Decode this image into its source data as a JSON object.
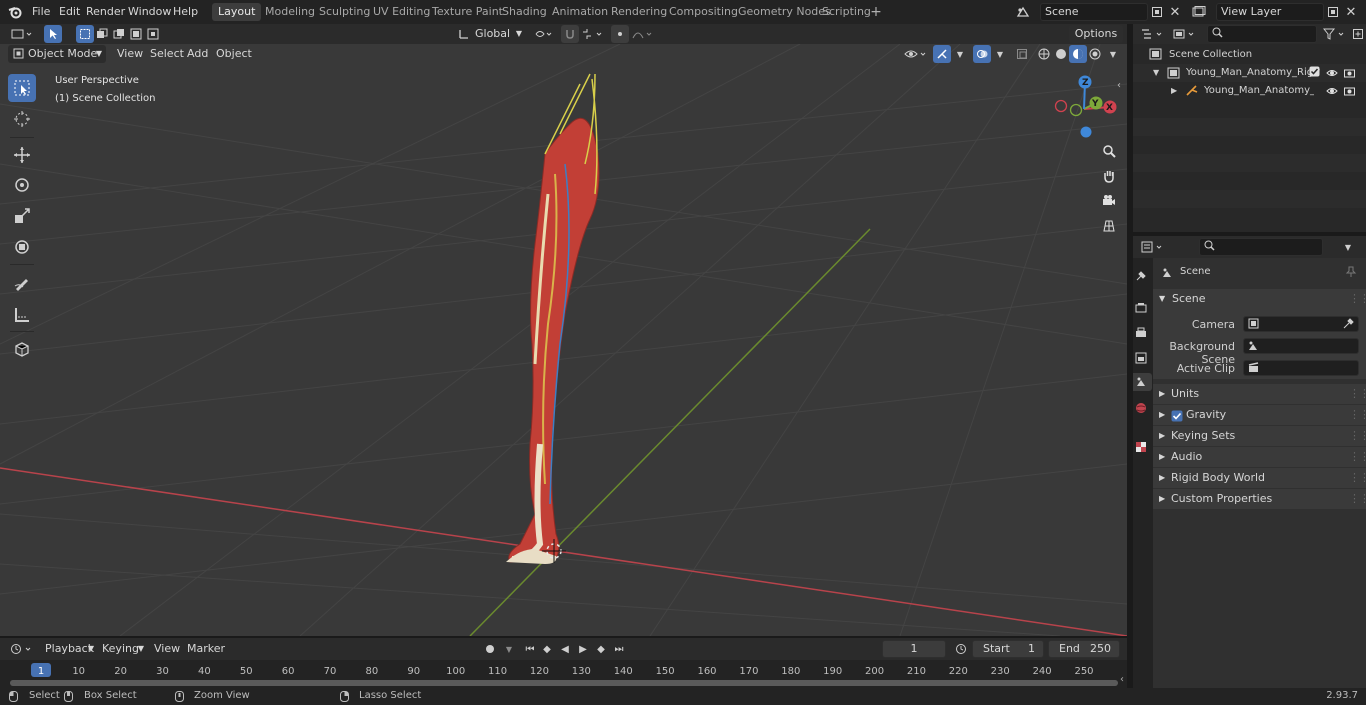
{
  "topbar": {
    "menus": [
      "File",
      "Edit",
      "Render",
      "Window",
      "Help"
    ],
    "workspaces": [
      "Layout",
      "Modeling",
      "Sculpting",
      "UV Editing",
      "Texture Paint",
      "Shading",
      "Animation",
      "Rendering",
      "Compositing",
      "Geometry Nodes",
      "Scripting"
    ],
    "active_workspace": "Layout",
    "scene_name": "Scene",
    "view_layer_name": "View Layer"
  },
  "tool_header": {
    "transform_orientation": "Global",
    "options_label": "Options"
  },
  "viewport_header": {
    "mode": "Object Mode",
    "menus": [
      "View",
      "Select",
      "Add",
      "Object"
    ]
  },
  "viewport": {
    "overlay_title": "User Perspective",
    "overlay_collection": "(1) Scene Collection",
    "gizmo_axes": {
      "x": "X",
      "y": "Y",
      "z": "Z"
    },
    "colors": {
      "x_axis": "#d0424f",
      "y_axis": "#7ea93a",
      "z_axis": "#3f88d9"
    }
  },
  "timeline": {
    "menus": [
      "Playback",
      "Keying",
      "View",
      "Marker"
    ],
    "current_frame": "1",
    "start_label": "Start",
    "start_value": "1",
    "end_label": "End",
    "end_value": "250",
    "ticks": [
      "1",
      "10",
      "20",
      "30",
      "40",
      "50",
      "60",
      "70",
      "80",
      "90",
      "100",
      "110",
      "120",
      "130",
      "140",
      "150",
      "160",
      "170",
      "180",
      "190",
      "200",
      "210",
      "220",
      "230",
      "240",
      "250"
    ]
  },
  "outliner": {
    "root": "Scene Collection",
    "items": [
      "Young_Man_Anatomy_Right_",
      "Young_Man_Anatomy_Ri"
    ]
  },
  "properties": {
    "context_title": "Scene",
    "panel_title": "Scene",
    "camera_label": "Camera",
    "background_scene_label": "Background Scene",
    "active_clip_label": "Active Clip",
    "sections": [
      "Units",
      "Gravity",
      "Keying Sets",
      "Audio",
      "Rigid Body World",
      "Custom Properties"
    ]
  },
  "statusbar": {
    "select": "Select",
    "box_select": "Box Select",
    "zoom_view": "Zoom View",
    "lasso_select": "Lasso Select",
    "version": "2.93.7"
  }
}
